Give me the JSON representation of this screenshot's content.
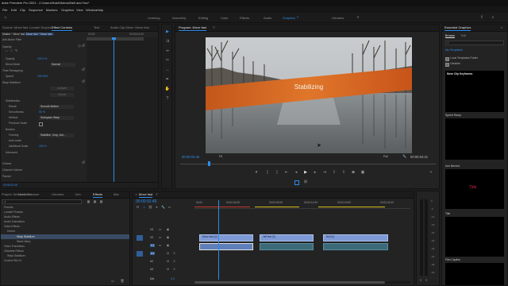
{
  "titlebar": {
    "title": "dobe Premiere Pro 2021 - C:\\Users\\Saki\\Videos\\Neil and Hox*",
    "menus": [
      "File",
      "Edit",
      "Clip",
      "Sequence",
      "Markers",
      "Graphics",
      "View",
      "Window",
      "Help"
    ]
  },
  "workspaces": {
    "items": [
      "Learning",
      "Assembly",
      "Editing",
      "Color",
      "Effects",
      "Audio",
      "Graphics",
      "Libraries"
    ],
    "active_index": 6
  },
  "effect_controls": {
    "tabs": [
      "Source: Move fast",
      "Lumetri Scopes",
      "Effect Controls",
      "Text",
      "Audio Clip Mixer: Move fast"
    ],
    "active_index": 2,
    "source_label": "Master * Move fast",
    "clip_label": "Move fast * Move fast",
    "time_start": "00:00",
    "time_end": "00:00:04:00",
    "rows": [
      {
        "label": "Anti-flicker Filter",
        "value": ""
      },
      {
        "label": "Opacity",
        "value": ""
      },
      {
        "label": "Opacity",
        "value": "100.0 %"
      },
      {
        "label": "Blend Mode",
        "value": "Normal"
      },
      {
        "label": "Time Remapping",
        "value": ""
      },
      {
        "label": "Speed",
        "value": "100.00%"
      },
      {
        "label": "Warp Stabilizer",
        "value": ""
      },
      {
        "label": "",
        "value": "Analyze"
      },
      {
        "label": "",
        "value": "Cancel"
      },
      {
        "label": "Stabilization",
        "value": ""
      },
      {
        "label": "Result",
        "value": "Smooth Motion"
      },
      {
        "label": "Smoothness",
        "value": "50 %"
      },
      {
        "label": "Method",
        "value": "Subspace Warp"
      },
      {
        "label": "Preserve Scale",
        "value": ""
      },
      {
        "label": "Borders",
        "value": ""
      },
      {
        "label": "Framing",
        "value": "Stabilize, Crop, Aut..."
      },
      {
        "label": "Auto-scale",
        "value": ""
      },
      {
        "label": "Additional Scale",
        "value": "100 %"
      },
      {
        "label": "Advanced",
        "value": ""
      },
      {
        "label": "Volume",
        "value": ""
      },
      {
        "label": "Channel Volume",
        "value": ""
      },
      {
        "label": "Panner",
        "value": ""
      }
    ],
    "footer_time": "00:00:02:45"
  },
  "program": {
    "title": "Program: Move fast",
    "overlay_text": "Stabilizing",
    "timecode": "00:00:02:45",
    "fit": "Fit",
    "quality": "Full",
    "duration": "00:00:04:21"
  },
  "essential_graphics": {
    "title": "Essential Graphics",
    "tabs": [
      "Browse",
      "Edit"
    ],
    "active_index": 0,
    "search_placeholder": "",
    "my_templates": "My Templates",
    "checkbox_local": "Local Templates Folder",
    "checkbox_libraries": "Libraries",
    "templates": [
      {
        "name": "Move Clip Keyframes",
        "label": ""
      },
      {
        "name": "Speed Ramp",
        "label": ""
      },
      {
        "name": "Iron Nerved",
        "label": ""
      },
      {
        "name": "Title",
        "label": "Title"
      },
      {
        "name": "Film Caption",
        "label": ""
      }
    ]
  },
  "effects": {
    "tabs": [
      "Project: Neil and Hox",
      "Media Browser",
      "Libraries",
      "Info",
      "Effects",
      "Mar"
    ],
    "active_index": 4,
    "items": [
      "Presets",
      "Lumetri Presets",
      "Audio Effects",
      "Audio Transitions",
      "Video Effects",
      "Distort",
      "Warp Stabilizer",
      "Wave Warp",
      "Video Transitions",
      "Obsolete Effects",
      "Warp Stabilizer",
      "Custom Bin 01"
    ]
  },
  "timeline": {
    "tab": "Move fast",
    "timecode": "00:00:02:45",
    "ruler": [
      "00:00",
      "00:00:04:59",
      "00:00:09:59",
      "00:00:14:59",
      "00:00:19:59",
      "00:00:24:59"
    ],
    "tracks": [
      "V3",
      "V2",
      "V1",
      "A1",
      "A2",
      "A3"
    ],
    "clips": [
      {
        "label": "Move fast [V]"
      },
      {
        "label": "Jeff fest [V]"
      },
      {
        "label": "Neil [V]"
      }
    ],
    "master": "Mix",
    "master_value": "0.0"
  },
  "audio_meter": {
    "label_db": [
      "0",
      "-6",
      "-12",
      "-18",
      "-24",
      "-30",
      "-36",
      "-42",
      "-48",
      "-54"
    ],
    "footer": [
      "S",
      "S"
    ]
  }
}
